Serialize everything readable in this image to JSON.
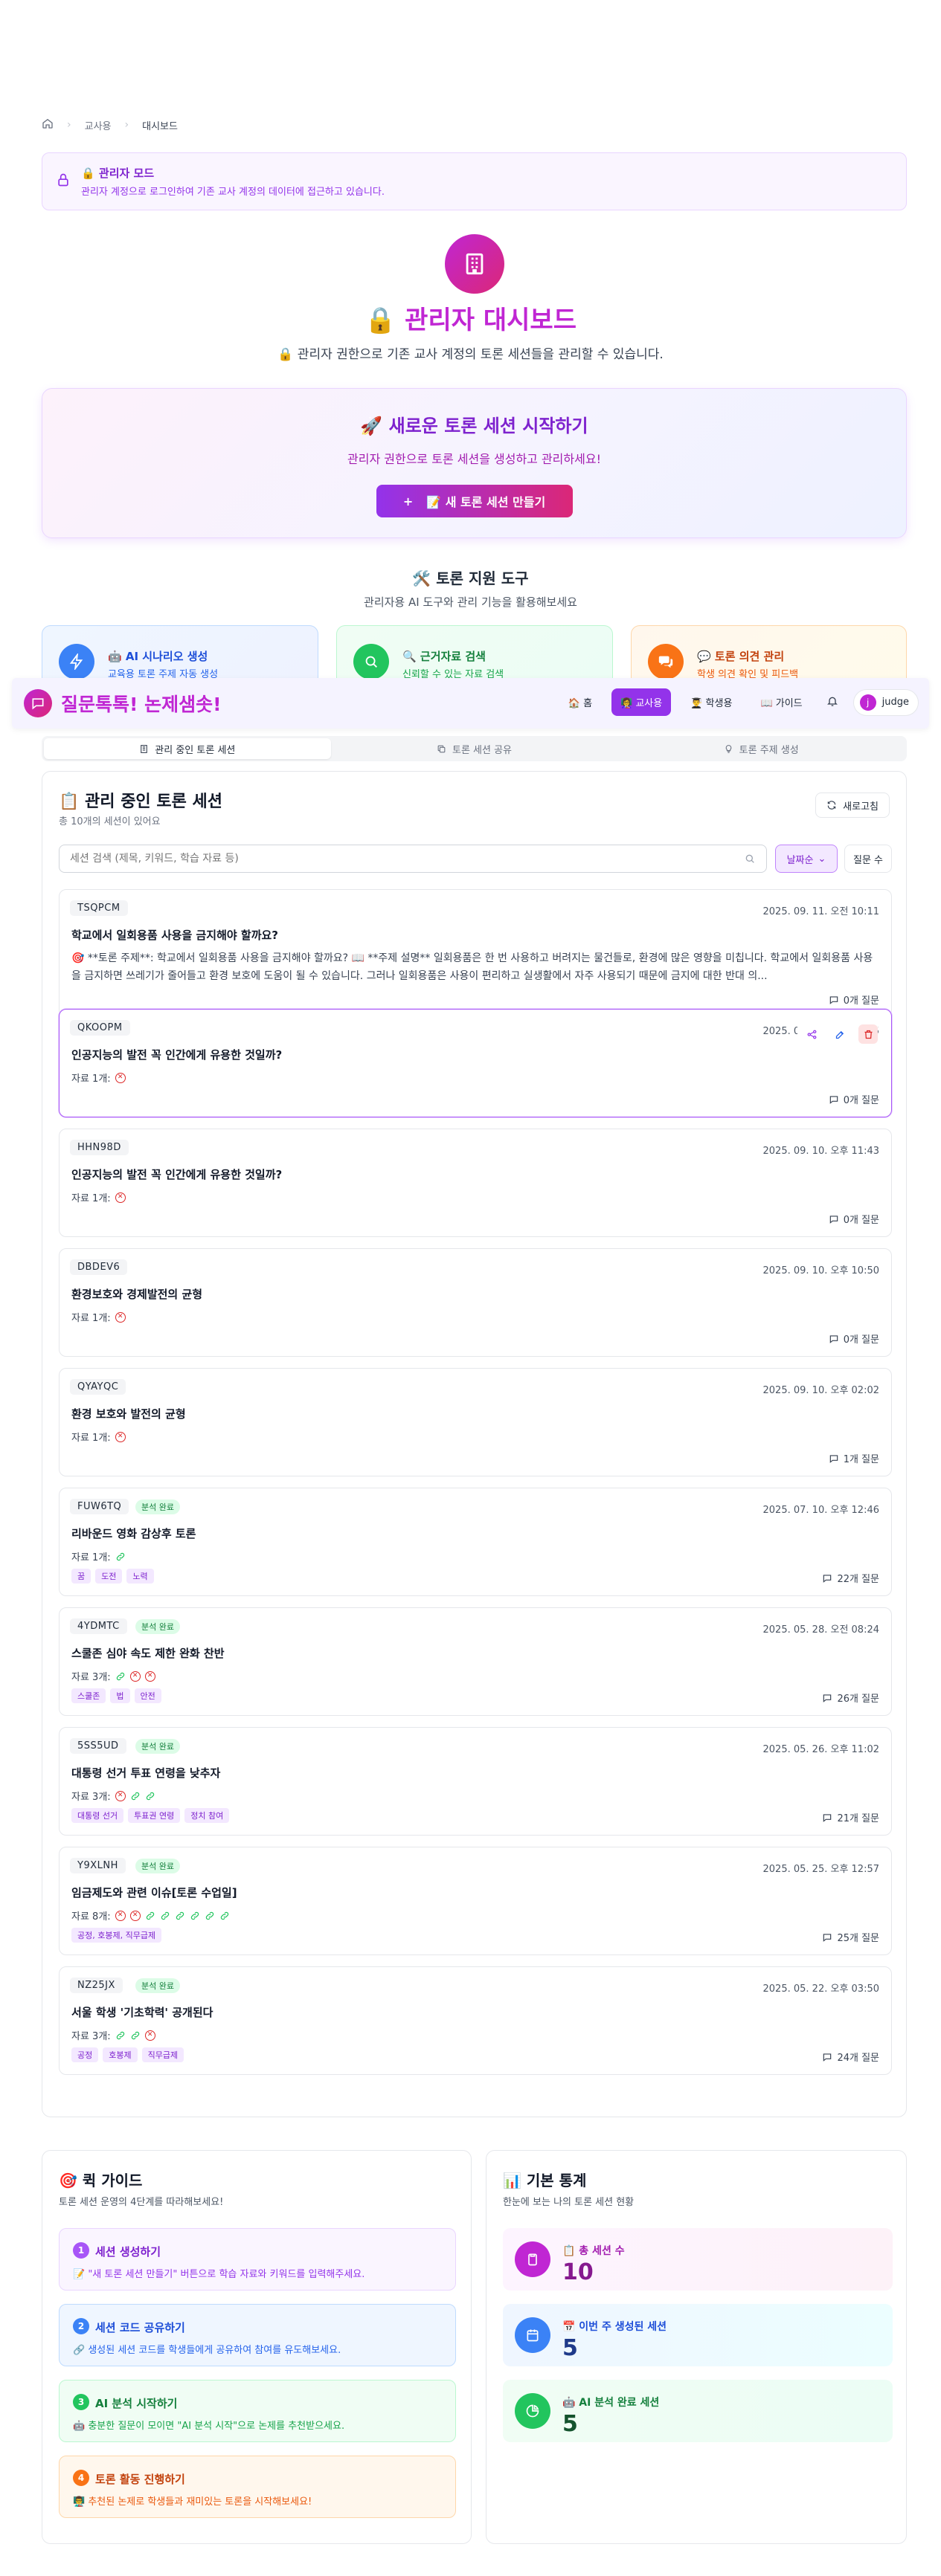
{
  "colors": {
    "accent": "#9333ea",
    "brand": "#c026d3",
    "pink": "#db2777"
  },
  "breadcrumb": {
    "home_icon": "home-icon",
    "items": [
      "교사용",
      "대시보드"
    ]
  },
  "admin_banner": {
    "title": "🔒 관리자 모드",
    "desc": "관리자 계정으로 로그인하여 기존 교사 계정의 데이터에 접근하고 있습니다."
  },
  "hero": {
    "title": "🔒 관리자 대시보드",
    "subtitle": "🔒 관리자 권한으로 기존 교사 계정의 토론 세션들을 관리할 수 있습니다."
  },
  "new_session": {
    "title": "🚀 새로운 토론 세션 시작하기",
    "desc": "관리자 권한으로 토론 세션을 생성하고 관리하세요!",
    "button_plus": "+",
    "button": "📝 새 토론 세션 만들기"
  },
  "tools": {
    "title": "🛠️ 토론 지원 도구",
    "subtitle": "관리자용 AI 도구와 관리 기능을 활용해보세요",
    "items": [
      {
        "title": "🤖 AI 시나리오 생성",
        "desc": "교육용 토론 주제 자동 생성"
      },
      {
        "title": "🔍 근거자료 검색",
        "desc": "신뢰할 수 있는 자료 검색"
      },
      {
        "title": "💬 토론 의견 관리",
        "desc": "학생 의견 확인 및 피드백"
      }
    ]
  },
  "nav": {
    "brand": "질문톡톡! 논제샘솟!",
    "items": [
      "🏠 홈",
      "👩‍🏫 교사용",
      "👨‍🎓 학생용",
      "📖 가이드"
    ],
    "active_index": 1,
    "user_initial": "j",
    "user": "judge"
  },
  "tabs": [
    "관리 중인 토론 세션",
    "토론 세션 공유",
    "토론 주제 생성"
  ],
  "sessions_panel": {
    "title": "📋 관리 중인 토론 세션",
    "subtitle": "총 10개의 세션이 있어요",
    "refresh": "새로고침",
    "search_placeholder": "세션 검색 (제목, 키워드, 학습 자료 등)",
    "sort": "날짜순",
    "qcount": "질문 수"
  },
  "sessions": [
    {
      "code": "TSQPCM",
      "badge": "",
      "date": "2025. 09. 11. 오전 10:11",
      "title": "학교에서 일회용품 사용을 금지해야 할까요?",
      "desc": "🎯 **토론 주제**: 학교에서 일회용품 사용을 금지해야 할까요? 📖 **주제 설명** 일회용품은 한 번 사용하고 버려지는 물건들로, 환경에 많은 영향을 미칩니다. 학교에서 일회용품 사용을 금지하면 쓰레기가 줄어들고 환경 보호에 도움이 될 수 있습니다. 그러나 일회용품은 사용이 편리하고 실생활에서 자주 사용되기 때문에 금지에 대한 반대 의...",
      "materials_label": "",
      "materials": [],
      "keywords": [],
      "questions": "0개 질문"
    },
    {
      "code": "QKOOPM",
      "badge": "",
      "date": "2025. 09. 11. 오전 10:05",
      "title": "인공지능의 발전 꼭 인간에게 유용한 것일까?",
      "desc": "",
      "materials_label": "자료 1개:",
      "materials": [
        "x"
      ],
      "keywords": [],
      "questions": "0개 질문"
    },
    {
      "code": "HHN98D",
      "badge": "",
      "date": "2025. 09. 10. 오후 11:43",
      "title": "인공지능의 발전 꼭 인간에게 유용한 것일까?",
      "desc": "",
      "materials_label": "자료 1개:",
      "materials": [
        "x"
      ],
      "keywords": [],
      "questions": "0개 질문"
    },
    {
      "code": "DBDEV6",
      "badge": "",
      "date": "2025. 09. 10. 오후 10:50",
      "title": "환경보호와 경제발전의 균형",
      "desc": "",
      "materials_label": "자료 1개:",
      "materials": [
        "x"
      ],
      "keywords": [],
      "questions": "0개 질문"
    },
    {
      "code": "QYAYQC",
      "badge": "",
      "date": "2025. 09. 10. 오후 02:02",
      "title": "환경 보호와 발전의 균형",
      "desc": "",
      "materials_label": "자료 1개:",
      "materials": [
        "x"
      ],
      "keywords": [],
      "questions": "1개 질문"
    },
    {
      "code": "FUW6TQ",
      "badge": "분석 완료",
      "date": "2025. 07. 10. 오후 12:46",
      "title": "리바운드 영화 감상후 토론",
      "desc": "",
      "materials_label": "자료 1개:",
      "materials": [
        "l"
      ],
      "keywords": [
        "꿈",
        "도전",
        "노력"
      ],
      "questions": "22개 질문"
    },
    {
      "code": "4YDMTC",
      "badge": "분석 완료",
      "date": "2025. 05. 28. 오전 08:24",
      "title": "스쿨존 심야 속도 제한 완화 찬반",
      "desc": "",
      "materials_label": "자료 3개:",
      "materials": [
        "l",
        "x",
        "x"
      ],
      "keywords": [
        "스쿨존",
        "법",
        "안전"
      ],
      "questions": "26개 질문"
    },
    {
      "code": "5SS5UD",
      "badge": "분석 완료",
      "date": "2025. 05. 26. 오후 11:02",
      "title": "대통령 선거 투표 연령을 낮추자",
      "desc": "",
      "materials_label": "자료 3개:",
      "materials": [
        "x",
        "l",
        "l"
      ],
      "keywords": [
        "대통령 선거",
        "투표권 연령",
        "정치 참여"
      ],
      "questions": "21개 질문"
    },
    {
      "code": "Y9XLNH",
      "badge": "분석 완료",
      "date": "2025. 05. 25. 오후 12:57",
      "title": "임금제도와 관련 이슈[토론 수업일]",
      "desc": "",
      "materials_label": "자료 8개:",
      "materials": [
        "x",
        "x",
        "l",
        "l",
        "l",
        "l",
        "l",
        "l"
      ],
      "keywords": [
        "공정, 호봉제, 직무급제"
      ],
      "questions": "25개 질문"
    },
    {
      "code": "NZ25JX",
      "badge": "분석 완료",
      "date": "2025. 05. 22. 오후 03:50",
      "title": "서울 학생 '기초학력' 공개된다",
      "desc": "",
      "materials_label": "자료 3개:",
      "materials": [
        "l",
        "l",
        "x"
      ],
      "keywords": [
        "공정",
        "호봉제",
        "직무급제"
      ],
      "questions": "24개 질문"
    }
  ],
  "quick_guide": {
    "title": "🎯 퀵 가이드",
    "subtitle": "토론 세션 운영의 4단계를 따라해보세요!",
    "steps": [
      {
        "num": "1",
        "title": "세션 생성하기",
        "desc": "📝 \"새 토론 세션 만들기\" 버튼으로 학습 자료와 키워드를 입력해주세요."
      },
      {
        "num": "2",
        "title": "세션 코드 공유하기",
        "desc": "🔗 생성된 세션 코드를 학생들에게 공유하여 참여를 유도해보세요."
      },
      {
        "num": "3",
        "title": "AI 분석 시작하기",
        "desc": "🤖 충분한 질문이 모이면 \"AI 분석 시작\"으로 논제를 추천받으세요."
      },
      {
        "num": "4",
        "title": "토론 활동 진행하기",
        "desc": "👨‍🏫 추천된 논제로 학생들과 재미있는 토론을 시작해보세요!"
      }
    ]
  },
  "stats": {
    "title": "📊 기본 통계",
    "subtitle": "한눈에 보는 나의 토론 세션 현황",
    "items": [
      {
        "label": "📋 총 세션 수",
        "value": "10"
      },
      {
        "label": "📅 이번 주 생성된 세션",
        "value": "5"
      },
      {
        "label": "🤖 AI 분석 완료 세션",
        "value": "5"
      }
    ]
  }
}
